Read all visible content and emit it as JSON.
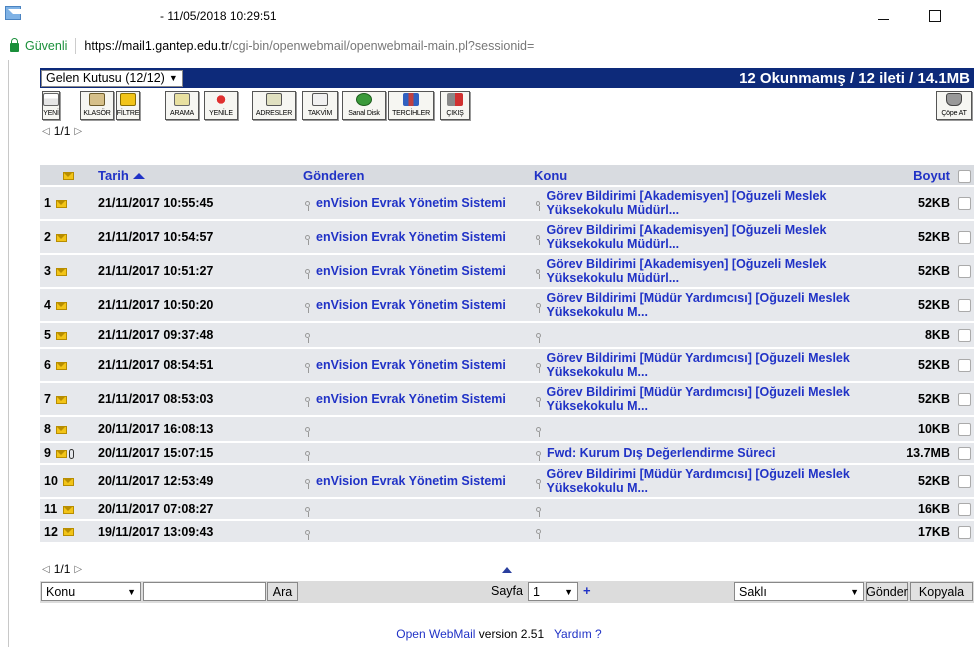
{
  "window": {
    "title": "- 11/05/2018 10:29:51"
  },
  "address": {
    "secure_label": "Güvenli",
    "url_host": "https://mail1.gantep.edu.tr",
    "url_path": "/cgi-bin/openwebmail/openwebmail-main.pl?sessionid="
  },
  "folder": {
    "selected": "Gelen Kutusu (12/12)",
    "summary": "12 Okunmamış / 12 ileti / 14.1MB"
  },
  "toolbar": {
    "new": "YENİ",
    "folders": "KLASÖR",
    "filter": "FİLTRE",
    "search": "ARAMA",
    "refresh": "YENİLE",
    "addresses": "ADRESLER",
    "calendar": "TAKVİM",
    "webdisk": "Sanal Disk",
    "prefs": "TERCİHLER",
    "logout": "ÇIKIŞ",
    "trash": "Çöpe AT"
  },
  "pager": {
    "label": "1/1"
  },
  "table": {
    "headers": {
      "date": "Tarih",
      "from": "Gönderen",
      "subject": "Konu",
      "size": "Boyut"
    },
    "rows": [
      {
        "num": "1",
        "date": "21/11/2017 10:55:45",
        "from": "enVision Evrak Yönetim Sistemi",
        "subject": "Görev Bildirimi [Akademisyen] [Oğuzeli Meslek Yüksekokulu Müdürl...",
        "size": "52KB"
      },
      {
        "num": "2",
        "date": "21/11/2017 10:54:57",
        "from": "enVision Evrak Yönetim Sistemi",
        "subject": "Görev Bildirimi [Akademisyen] [Oğuzeli Meslek Yüksekokulu Müdürl...",
        "size": "52KB"
      },
      {
        "num": "3",
        "date": "21/11/2017 10:51:27",
        "from": "enVision Evrak Yönetim Sistemi",
        "subject": "Görev Bildirimi [Akademisyen] [Oğuzeli Meslek Yüksekokulu Müdürl...",
        "size": "52KB"
      },
      {
        "num": "4",
        "date": "21/11/2017 10:50:20",
        "from": "enVision Evrak Yönetim Sistemi",
        "subject": "Görev Bildirimi [Müdür Yardımcısı] [Oğuzeli Meslek Yüksekokulu M...",
        "size": "52KB"
      },
      {
        "num": "5",
        "date": "21/11/2017 09:37:48",
        "from": "",
        "subject": "",
        "size": "8KB"
      },
      {
        "num": "6",
        "date": "21/11/2017 08:54:51",
        "from": "enVision Evrak Yönetim Sistemi",
        "subject": "Görev Bildirimi [Müdür Yardımcısı] [Oğuzeli Meslek Yüksekokulu M...",
        "size": "52KB"
      },
      {
        "num": "7",
        "date": "21/11/2017 08:53:03",
        "from": "enVision Evrak Yönetim Sistemi",
        "subject": "Görev Bildirimi [Müdür Yardımcısı] [Oğuzeli Meslek Yüksekokulu M...",
        "size": "52KB"
      },
      {
        "num": "8",
        "date": "20/11/2017 16:08:13",
        "from": "",
        "subject": "",
        "size": "10KB"
      },
      {
        "num": "9",
        "date": "20/11/2017 15:07:15",
        "from": "",
        "subject": "Fwd: Kurum Dış Değerlendirme Süreci",
        "size": "13.7MB"
      },
      {
        "num": "10",
        "date": "20/11/2017 12:53:49",
        "from": "enVision Evrak Yönetim Sistemi",
        "subject": "Görev Bildirimi [Müdür Yardımcısı] [Oğuzeli Meslek Yüksekokulu M...",
        "size": "52KB"
      },
      {
        "num": "11",
        "date": "20/11/2017 07:08:27",
        "from": "",
        "subject": "",
        "size": "16KB"
      },
      {
        "num": "12",
        "date": "19/11/2017 13:09:43",
        "from": "",
        "subject": "",
        "size": "17KB"
      }
    ]
  },
  "bottom": {
    "search_field": "Konu",
    "search_button": "Ara",
    "page_label": "Sayfa",
    "page_value": "1",
    "plus": "+",
    "move_target": "Saklı",
    "send_button": "Gönder",
    "copy_button": "Kopyala"
  },
  "footer": {
    "product": "Open WebMail",
    "version": "version 2.51",
    "help": "Yardım ?"
  }
}
